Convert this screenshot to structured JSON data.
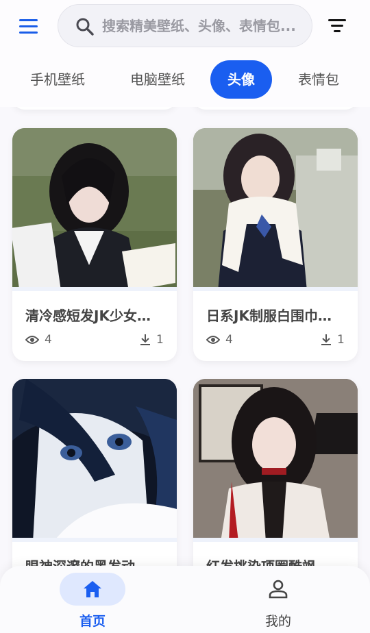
{
  "header": {
    "search_placeholder": "搜索精美壁纸、头像、表情包...",
    "menu_icon": "menu-icon",
    "filter_icon": "filter-icon",
    "search_icon": "search-icon"
  },
  "tabs": [
    {
      "label": "手机壁纸",
      "active": false
    },
    {
      "label": "电脑壁纸",
      "active": false
    },
    {
      "label": "头像",
      "active": true
    },
    {
      "label": "表情包",
      "active": false
    }
  ],
  "cards": [
    {
      "title": "清冷感短发JK少女…",
      "views": "4",
      "downloads": "1"
    },
    {
      "title": "日系JK制服白围巾…",
      "views": "4",
      "downloads": "1"
    },
    {
      "title": "眼神深邃的黑发动…",
      "views": "",
      "downloads": ""
    },
    {
      "title": "红发挑染项圈酷飒…",
      "views": "",
      "downloads": ""
    }
  ],
  "bottom_nav": [
    {
      "label": "首页",
      "icon": "home-icon",
      "active": true
    },
    {
      "label": "我的",
      "icon": "person-icon",
      "active": false
    }
  ],
  "colors": {
    "accent": "#1a5ef0",
    "accent_light": "#dfe8fe"
  }
}
